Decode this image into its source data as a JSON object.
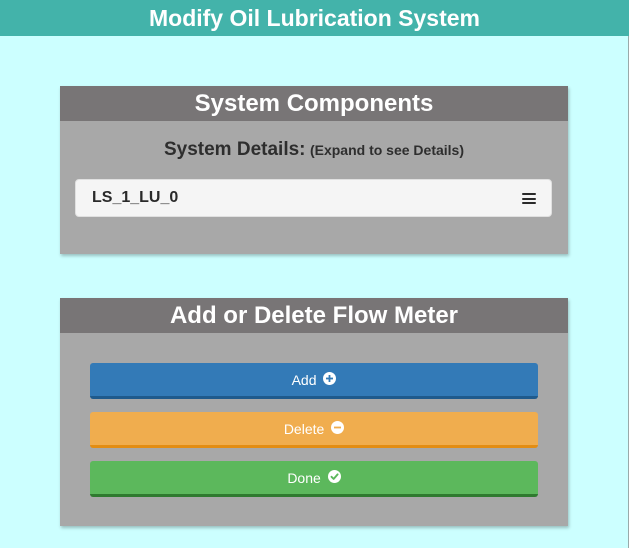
{
  "header": {
    "title": "Modify Oil Lubrication System"
  },
  "components_panel": {
    "title": "System Components",
    "details_label": "System Details:",
    "details_hint": "(Expand to see Details)",
    "accordion_item": {
      "title": "LS_1_LU_0",
      "icon": "hamburger-menu-icon"
    }
  },
  "flow_meter_panel": {
    "title": "Add or Delete Flow Meter",
    "buttons": {
      "add": {
        "label": "Add",
        "icon": "plus-circle-icon",
        "color": "#337ab7"
      },
      "delete": {
        "label": "Delete",
        "icon": "minus-circle-icon",
        "color": "#f0ad4e"
      },
      "done": {
        "label": "Done",
        "icon": "check-circle-icon",
        "color": "#5cb85c"
      }
    }
  },
  "colors": {
    "page_background": "#ccffff",
    "header_background": "#43b3aa",
    "panel_header": "#787576",
    "panel_body": "#a8a8a8"
  }
}
